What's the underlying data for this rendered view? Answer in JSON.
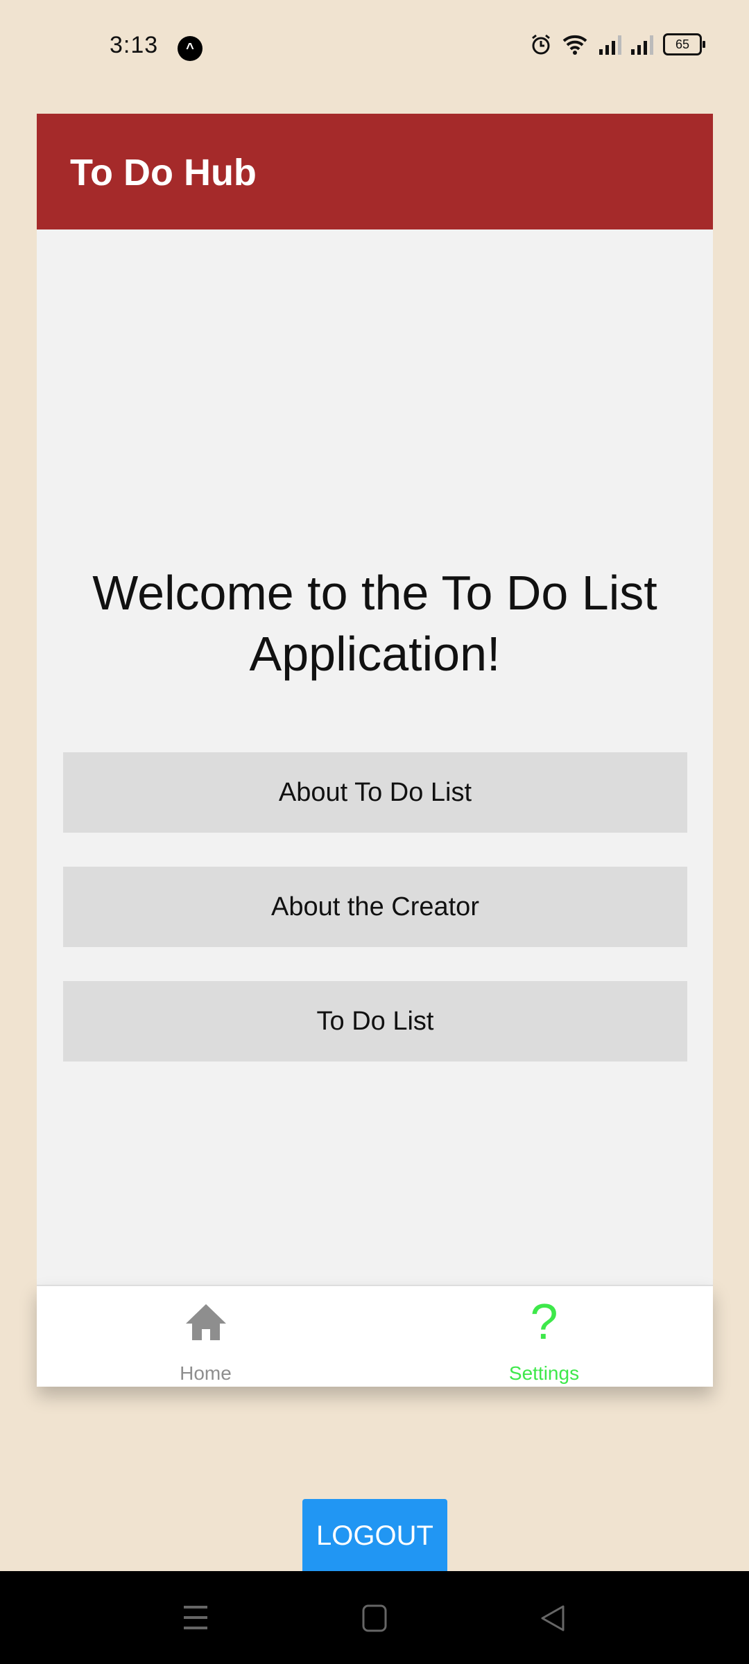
{
  "status_bar": {
    "time": "3:13",
    "battery": "65"
  },
  "header": {
    "title": "To Do Hub",
    "color": "#a52a2a"
  },
  "main": {
    "welcome": "Welcome to the To Do List Application!",
    "buttons": [
      {
        "label": "About To Do List"
      },
      {
        "label": "About the Creator"
      },
      {
        "label": "To Do List"
      }
    ]
  },
  "tabs": [
    {
      "label": "Home",
      "icon": "home-icon",
      "color": "#8e8e8e"
    },
    {
      "label": "Settings",
      "icon": "question-mark-icon",
      "color": "#3ee84a",
      "active": true
    }
  ],
  "logout": {
    "label": "LOGOUT",
    "color": "#2196f3"
  }
}
